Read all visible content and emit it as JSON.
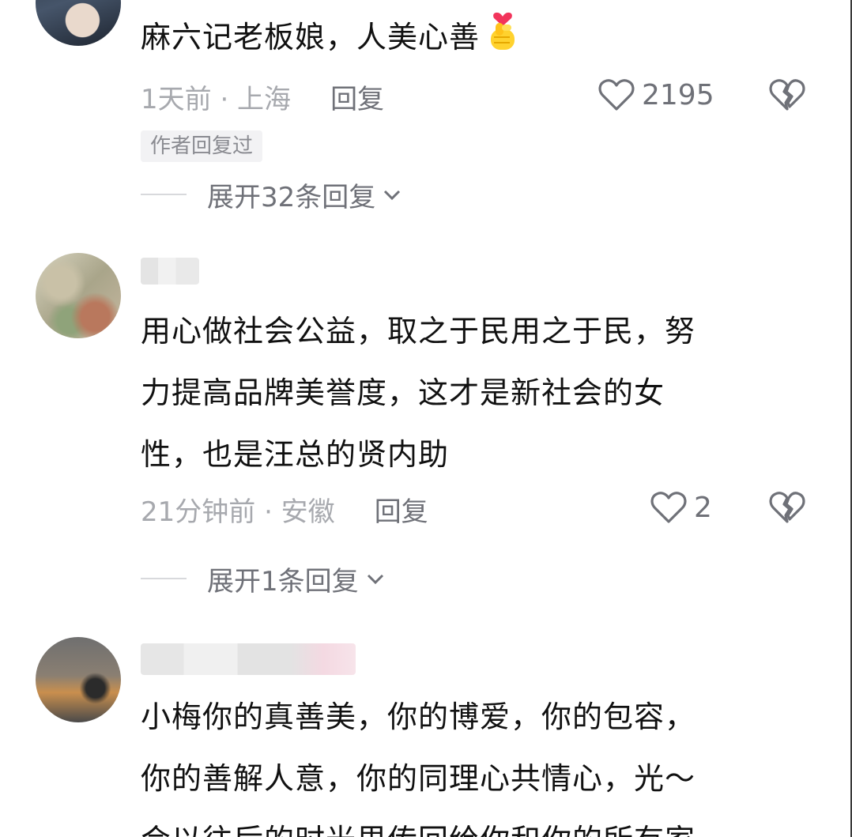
{
  "comments": [
    {
      "text": "麻六记老板娘，人美心善",
      "emoji": "finger-heart-emoji",
      "time_location": "1天前 · 上海",
      "reply_label": "回复",
      "likes": "2195",
      "badge": "作者回复过",
      "expand_label": "展开32条回复"
    },
    {
      "text_lines": [
        "用心做社会公益，取之于民用之于民，努",
        "力提高品牌美誉度，这才是新社会的女",
        "性，也是汪总的贤内助"
      ],
      "time_location": "21分钟前 · 安徽",
      "reply_label": "回复",
      "likes": "2",
      "expand_label": "展开1条回复"
    },
    {
      "text_lines": [
        "小梅你的真善美，你的博爱，你的包容，",
        "你的善解人意，你的同理心共情心，光～",
        "会以往后的时光里传回给你和你的所有家"
      ]
    }
  ],
  "icons": {
    "like": "heart-outline-icon",
    "dislike": "broken-heart-icon",
    "expand": "chevron-down-icon"
  },
  "colors": {
    "text": "#111111",
    "meta": "#a7a9ae",
    "action": "#6f7178",
    "badge_bg": "#f2f2f4"
  }
}
